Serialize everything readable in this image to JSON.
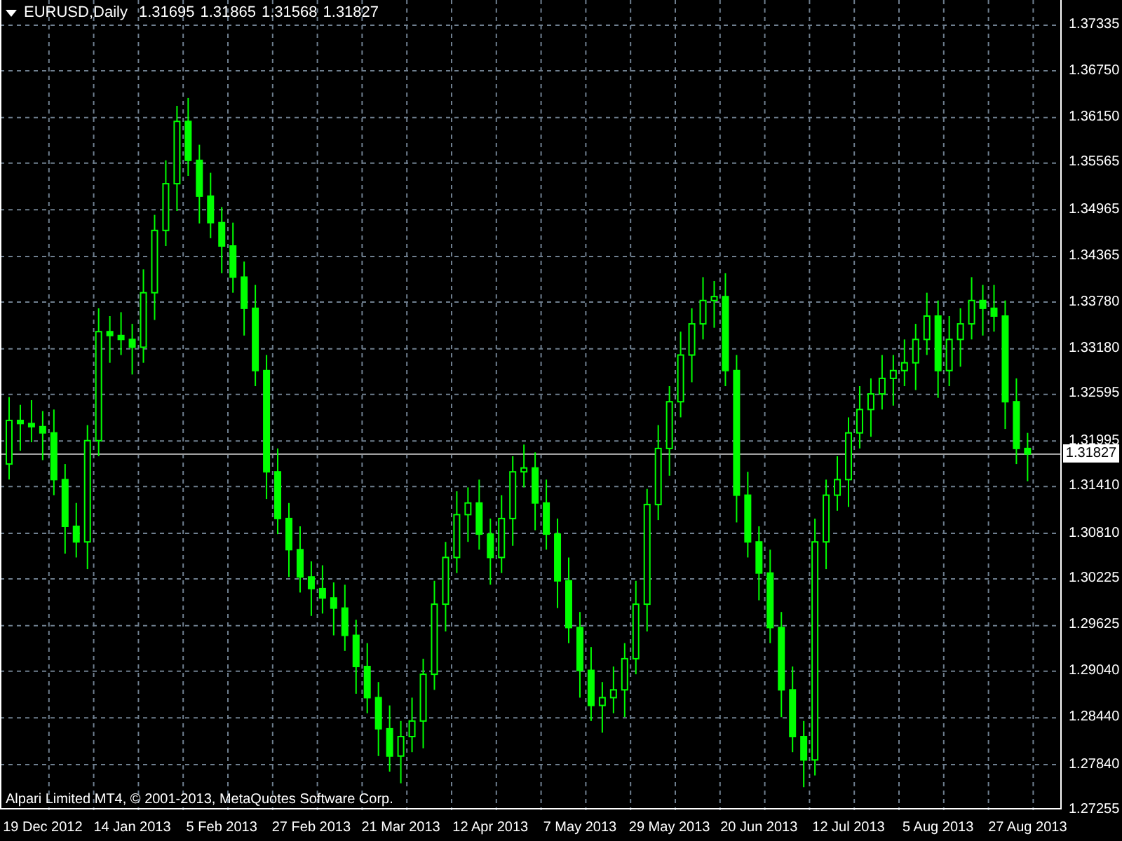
{
  "chart_header": {
    "symbol": "EURUSD,Daily",
    "quotes": [
      "1.31695",
      "1.31865",
      "1.31568",
      "1.31827"
    ]
  },
  "chart_data": {
    "type": "candlestick",
    "categories": [
      null,
      null,
      null,
      "19 Dec 2012",
      null,
      null,
      null,
      null,
      null,
      null,
      null,
      "14 Jan 2013",
      null,
      null,
      null,
      null,
      null,
      null,
      null,
      "5 Feb 2013",
      null,
      null,
      null,
      null,
      null,
      null,
      null,
      "27 Feb 2013",
      null,
      null,
      null,
      null,
      null,
      null,
      null,
      "21 Mar 2013",
      null,
      null,
      null,
      null,
      null,
      null,
      null,
      "12 Apr 2013",
      null,
      null,
      null,
      null,
      null,
      null,
      null,
      "7 May 2013",
      null,
      null,
      null,
      null,
      null,
      null,
      null,
      "29 May 2013",
      null,
      null,
      null,
      null,
      null,
      null,
      null,
      "20 Jun 2013",
      null,
      null,
      null,
      null,
      null,
      null,
      null,
      "12 Jul 2013",
      null,
      null,
      null,
      null,
      null,
      null,
      null,
      "5 Aug 2013",
      null,
      null,
      null,
      null,
      null,
      null,
      null,
      "27 Aug 2013"
    ],
    "grid": true,
    "ref_lines": [
      {
        "axis": "y",
        "value": 1.31827,
        "label": "1.31827"
      }
    ],
    "ohlc": [
      [
        1.317,
        1.3256,
        1.315,
        1.3226
      ],
      [
        1.3226,
        1.3246,
        1.3187,
        1.3222
      ],
      [
        1.3222,
        1.3252,
        1.3198,
        1.3218
      ],
      [
        1.3218,
        1.3238,
        1.3175,
        1.321
      ],
      [
        1.321,
        1.324,
        1.313,
        1.315
      ],
      [
        1.315,
        1.317,
        1.3055,
        1.309
      ],
      [
        1.309,
        1.312,
        1.305,
        1.307
      ],
      [
        1.307,
        1.322,
        1.3035,
        1.32
      ],
      [
        1.32,
        1.337,
        1.318,
        1.334
      ],
      [
        1.334,
        1.336,
        1.33,
        1.3335
      ],
      [
        1.3335,
        1.3365,
        1.331,
        1.333
      ],
      [
        1.333,
        1.335,
        1.3285,
        1.332
      ],
      [
        1.332,
        1.342,
        1.33,
        1.339
      ],
      [
        1.339,
        1.349,
        1.3355,
        1.347
      ],
      [
        1.347,
        1.356,
        1.345,
        1.353
      ],
      [
        1.353,
        1.363,
        1.3495,
        1.361
      ],
      [
        1.361,
        1.364,
        1.354,
        1.356
      ],
      [
        1.356,
        1.358,
        1.3479,
        1.3514
      ],
      [
        1.3514,
        1.3544,
        1.346,
        1.348
      ],
      [
        1.348,
        1.35,
        1.3415,
        1.345
      ],
      [
        1.345,
        1.348,
        1.339,
        1.341
      ],
      [
        1.341,
        1.343,
        1.3335,
        1.337
      ],
      [
        1.337,
        1.34,
        1.327,
        1.329
      ],
      [
        1.329,
        1.331,
        1.3125,
        1.316
      ],
      [
        1.316,
        1.319,
        1.308,
        1.31
      ],
      [
        1.31,
        1.312,
        1.3025,
        1.306
      ],
      [
        1.306,
        1.309,
        1.3005,
        1.3025
      ],
      [
        1.3025,
        1.3045,
        1.2975,
        1.301
      ],
      [
        1.301,
        1.304,
        1.2978,
        1.2998
      ],
      [
        1.2998,
        1.3018,
        1.295,
        1.2985
      ],
      [
        1.2985,
        1.3015,
        1.293,
        1.295
      ],
      [
        1.295,
        1.297,
        1.2875,
        1.291
      ],
      [
        1.291,
        1.294,
        1.285,
        1.287
      ],
      [
        1.287,
        1.289,
        1.2795,
        1.283
      ],
      [
        1.283,
        1.286,
        1.2775,
        1.2795
      ],
      [
        1.2795,
        1.284,
        1.276,
        1.282
      ],
      [
        1.282,
        1.287,
        1.28,
        1.284
      ],
      [
        1.284,
        1.292,
        1.2805,
        1.29
      ],
      [
        1.29,
        1.302,
        1.288,
        1.299
      ],
      [
        1.299,
        1.307,
        1.2955,
        1.305
      ],
      [
        1.305,
        1.3135,
        1.303,
        1.3105
      ],
      [
        1.3105,
        1.314,
        1.307,
        1.312
      ],
      [
        1.312,
        1.315,
        1.306,
        1.308
      ],
      [
        1.308,
        1.31,
        1.3015,
        1.305
      ],
      [
        1.305,
        1.313,
        1.303,
        1.31
      ],
      [
        1.31,
        1.318,
        1.3065,
        1.316
      ],
      [
        1.316,
        1.3195,
        1.314,
        1.3165
      ],
      [
        1.3165,
        1.3185,
        1.3085,
        1.312
      ],
      [
        1.312,
        1.315,
        1.306,
        1.308
      ],
      [
        1.308,
        1.31,
        1.2985,
        1.302
      ],
      [
        1.302,
        1.305,
        1.294,
        1.296
      ],
      [
        1.296,
        1.298,
        1.287,
        1.2905
      ],
      [
        1.2905,
        1.2935,
        1.284,
        1.286
      ],
      [
        1.286,
        1.289,
        1.2825,
        1.287
      ],
      [
        1.287,
        1.291,
        1.285,
        1.288
      ],
      [
        1.288,
        1.294,
        1.2845,
        1.292
      ],
      [
        1.292,
        1.302,
        1.29,
        1.299
      ],
      [
        1.299,
        1.3138,
        1.2955,
        1.3118
      ],
      [
        1.3118,
        1.322,
        1.3098,
        1.319
      ],
      [
        1.319,
        1.327,
        1.3155,
        1.325
      ],
      [
        1.325,
        1.334,
        1.323,
        1.331
      ],
      [
        1.331,
        1.337,
        1.3275,
        1.335
      ],
      [
        1.335,
        1.341,
        1.333,
        1.338
      ],
      [
        1.338,
        1.3405,
        1.3345,
        1.3385
      ],
      [
        1.3385,
        1.3415,
        1.327,
        1.329
      ],
      [
        1.329,
        1.331,
        1.3095,
        1.313
      ],
      [
        1.313,
        1.316,
        1.305,
        1.307
      ],
      [
        1.307,
        1.309,
        1.2995,
        1.303
      ],
      [
        1.303,
        1.306,
        1.294,
        1.296
      ],
      [
        1.296,
        1.298,
        1.2845,
        1.288
      ],
      [
        1.288,
        1.291,
        1.28,
        1.282
      ],
      [
        1.282,
        1.284,
        1.2755,
        1.279
      ],
      [
        1.279,
        1.31,
        1.277,
        1.307
      ],
      [
        1.307,
        1.315,
        1.3035,
        1.313
      ],
      [
        1.313,
        1.318,
        1.311,
        1.315
      ],
      [
        1.315,
        1.323,
        1.3115,
        1.321
      ],
      [
        1.321,
        1.327,
        1.319,
        1.324
      ],
      [
        1.324,
        1.328,
        1.3205,
        1.326
      ],
      [
        1.326,
        1.331,
        1.324,
        1.328
      ],
      [
        1.328,
        1.331,
        1.3245,
        1.329
      ],
      [
        1.329,
        1.333,
        1.327,
        1.33
      ],
      [
        1.33,
        1.335,
        1.3265,
        1.333
      ],
      [
        1.333,
        1.339,
        1.331,
        1.336
      ],
      [
        1.336,
        1.338,
        1.3255,
        1.329
      ],
      [
        1.329,
        1.336,
        1.327,
        1.333
      ],
      [
        1.333,
        1.337,
        1.3295,
        1.335
      ],
      [
        1.335,
        1.341,
        1.333,
        1.338
      ],
      [
        1.338,
        1.34,
        1.3335,
        1.337
      ],
      [
        1.337,
        1.34,
        1.334,
        1.336
      ],
      [
        1.336,
        1.338,
        1.3215,
        1.325
      ],
      [
        1.325,
        1.328,
        1.317,
        1.319
      ],
      [
        1.319,
        1.321,
        1.3148,
        1.3183
      ]
    ],
    "ylim": [
      1.27255,
      1.37335
    ],
    "yticks": [
      {
        "value": 1.37335,
        "label": "1.37335"
      },
      {
        "value": 1.3675,
        "label": "1.36750"
      },
      {
        "value": 1.3615,
        "label": "1.36150"
      },
      {
        "value": 1.35565,
        "label": "1.35565"
      },
      {
        "value": 1.34965,
        "label": "1.34965"
      },
      {
        "value": 1.34365,
        "label": "1.34365"
      },
      {
        "value": 1.3378,
        "label": "1.33780"
      },
      {
        "value": 1.3318,
        "label": "1.33180"
      },
      {
        "value": 1.32595,
        "label": "1.32595"
      },
      {
        "value": 1.31995,
        "label": "1.31995"
      },
      {
        "value": 1.3141,
        "label": "1.31410"
      },
      {
        "value": 1.3081,
        "label": "1.30810"
      },
      {
        "value": 1.30225,
        "label": "1.30225"
      },
      {
        "value": 1.29625,
        "label": "1.29625"
      },
      {
        "value": 1.2904,
        "label": "1.29040"
      },
      {
        "value": 1.2844,
        "label": "1.28440"
      },
      {
        "value": 1.2784,
        "label": "1.27840"
      },
      {
        "value": 1.27255,
        "label": "1.27255"
      }
    ]
  },
  "copyright": "Alpari Limited MT4, © 2001-2013, MetaQuotes Software Corp."
}
